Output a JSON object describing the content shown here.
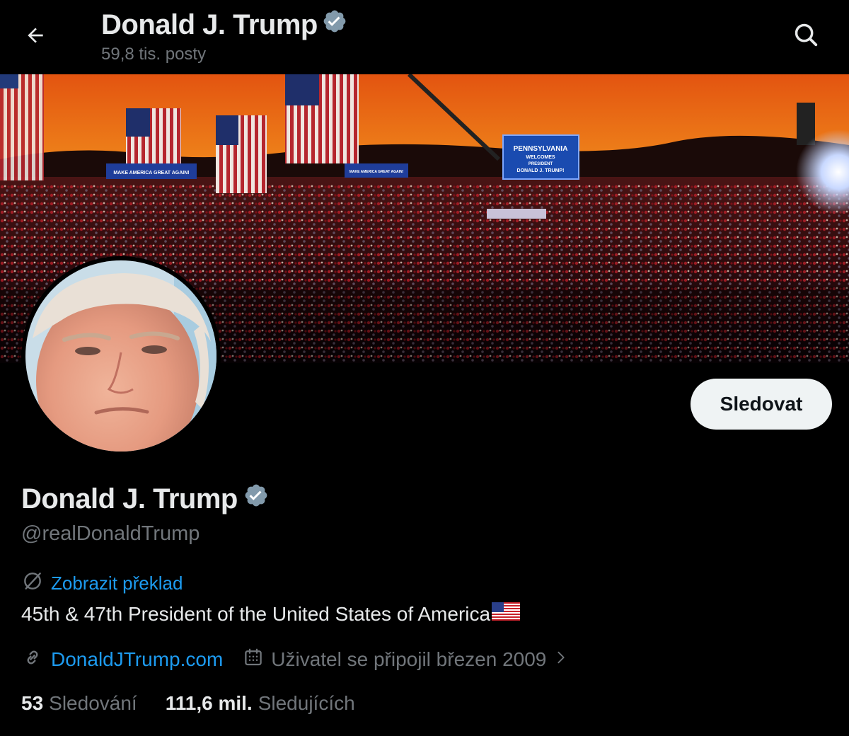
{
  "header": {
    "name": "Donald J. Trump",
    "posts": "59,8 tis. posty",
    "back_icon": "arrow-left-icon",
    "search_icon": "search-icon"
  },
  "banner": {
    "sign_main": "PENNSYLVANIA",
    "sign_line2": "WELCOMES",
    "sign_line3": "PRESIDENT",
    "sign_line4": "DONALD J. TRUMP!",
    "banner_left": "MAKE AMERICA GREAT AGAIN!",
    "banner_right": "MAKE AMERICA GREAT AGAIN!"
  },
  "profile": {
    "name": "Donald J. Trump",
    "handle": "@realDonaldTrump",
    "verified_color": "#829aab",
    "follow_label": "Sledovat",
    "translate_label": "Zobrazit překlad",
    "bio": "45th & 47th President of the United States of America",
    "website": "DonaldJTrump.com",
    "joined": "Uživatel se připojil březen 2009"
  },
  "stats": {
    "following_count": "53",
    "following_label": "Sledování",
    "followers_count": "111,6 mil.",
    "followers_label": "Sledujících"
  },
  "colors": {
    "accent": "#1d9bf0",
    "muted": "#71767b",
    "text": "#e7e9ea"
  }
}
